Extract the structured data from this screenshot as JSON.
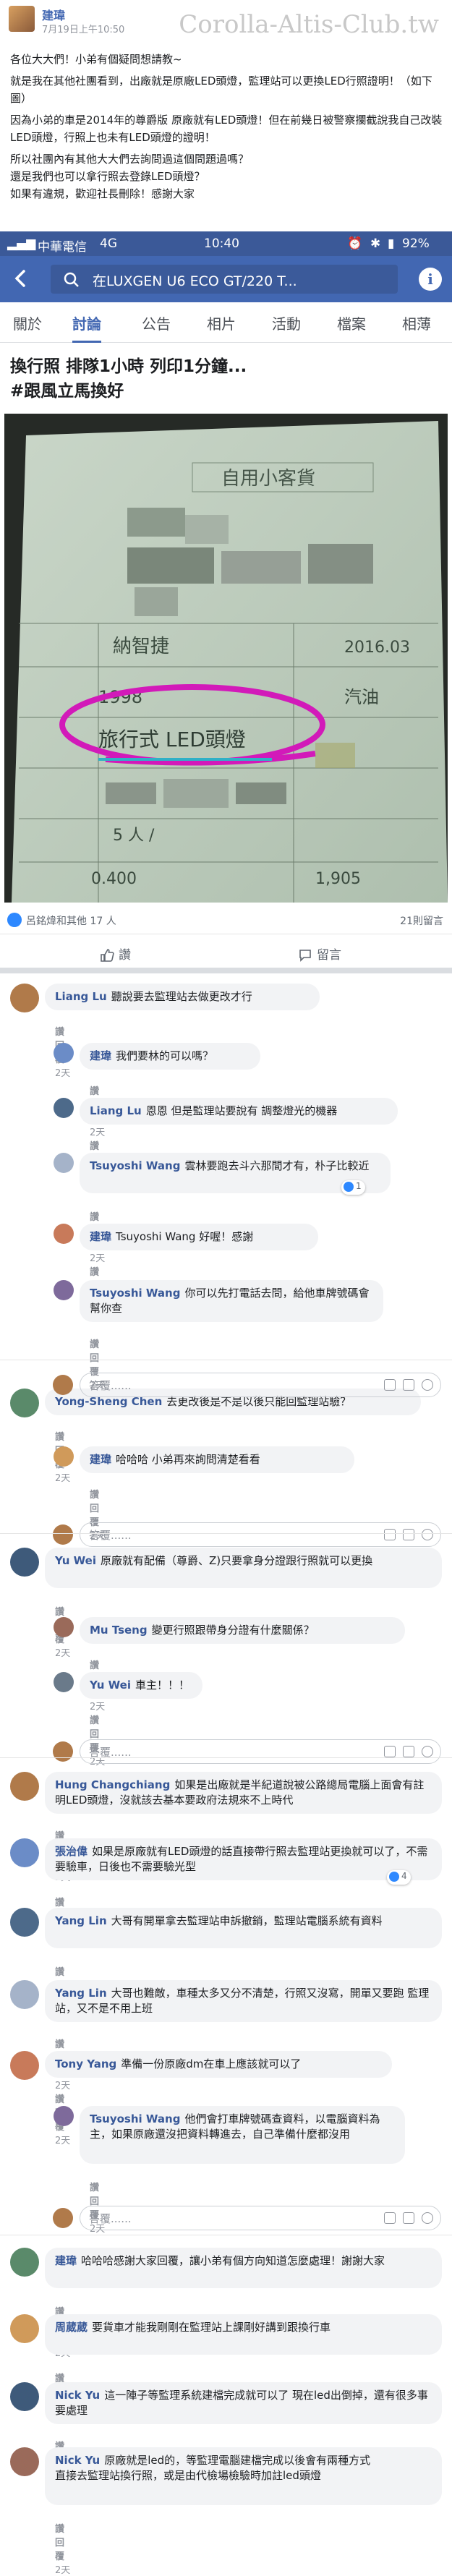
{
  "forum": {
    "author": "建瑋",
    "time": "7月19日上午10:50",
    "watermark": "Corolla-Altis-Club.tw",
    "paragraphs": [
      "各位大大們！小弟有個疑問想請教~",
      "就是我在其他社團看到，出廠就是原廠LED頭燈，監理站可以更換LED行照證明！（如下圖）",
      "因為小弟的車是2014年的尊爵版 原廠就有LED頭燈！但在前幾日被警察攔截說我自己改裝LED頭燈，行照上也未有LED頭燈的證明！",
      "所以社團內有其他大大們去詢問過這個問題過嗎？\n還是我們也可以拿行照去登錄LED頭燈？\n如果有違規，歡迎社長刪除！感謝大家"
    ],
    "highlight_text": "LED行照證明！（如下圖）"
  },
  "status": {
    "carrier": "中華電信",
    "network": "4G",
    "time": "10:40",
    "battery": "92%"
  },
  "appbar": {
    "search_text": "在LUXGEN U6 ECO GT/220 T..."
  },
  "tabs": [
    "關於",
    "討論",
    "公告",
    "相片",
    "活動",
    "檔案",
    "相薄"
  ],
  "post": {
    "title_line1": "換行照 排隊1小時 列印1分鐘...",
    "hashtag": "#跟風立馬換好"
  },
  "photo": {
    "header": "自用小客貨",
    "name": "納智捷",
    "date": "2016.03",
    "year": "1998",
    "fuel": "汽油",
    "led_text": "旅行式 LED頭燈",
    "seats": "5 人 /",
    "weight1": "0.400",
    "weight2": "1,905"
  },
  "reactions": {
    "who": "呂銘煒和其他 17 人",
    "comments_count": "21則留言"
  },
  "actions": {
    "like": "讚",
    "comment": "留言"
  },
  "comments": [
    {
      "name": "Liang Lu",
      "text": "聽說要去監理站去做更改才行",
      "meta_like": "讚",
      "meta_reply": "回覆",
      "meta_time": "2天"
    },
    {
      "name": "建瑋",
      "text": "我們要林的可以嗎？",
      "meta_like": "讚",
      "meta_reply": "回覆",
      "meta_time": "2天"
    },
    {
      "name": "Liang Lu",
      "text": "恩恩 但是監理站要說有 調整燈光的機器",
      "meta_like": "讚",
      "meta_reply": "回覆",
      "meta_time": "2天"
    },
    {
      "name": "Tsuyoshi Wang",
      "text": "雲林要跑去斗六那間才有，朴子比較近",
      "meta_like": "讚",
      "meta_reply": "回覆",
      "meta_time": "2天",
      "pill": "1"
    },
    {
      "name": "建瑋",
      "text": "Tsuyoshi Wang 好喔！感謝",
      "meta_like": "讚",
      "meta_reply": "回覆",
      "meta_time": "2天"
    },
    {
      "name": "Tsuyoshi Wang",
      "text": "你可以先打電話去問，給他車牌號碼會幫你查",
      "meta_like": "讚",
      "meta_reply": "回覆",
      "meta_time": "2天"
    },
    {
      "name": "Yong-Sheng Chen",
      "text": "去更改後是不是以後只能回監理站驗？",
      "meta_like": "讚",
      "meta_reply": "回覆",
      "meta_time": "2天"
    },
    {
      "name": "建瑋",
      "text": "哈哈哈 小弟再來詢問清楚看看",
      "meta_like": "讚",
      "meta_reply": "回覆",
      "meta_time": "2天"
    },
    {
      "name": "Yu Wei",
      "text": "原廠就有配備（尊爵、Z)只要拿身分證跟行照就可以更換",
      "meta_like": "讚",
      "meta_reply": "回覆",
      "meta_time": "2天"
    },
    {
      "name": "Mu Tseng",
      "text": "變更行照跟帶身分證有什麼關係？",
      "meta_like": "讚",
      "meta_reply": "回覆",
      "meta_time": "2天"
    },
    {
      "name": "Yu Wei",
      "text": "車主！！！",
      "meta_like": "讚",
      "meta_reply": "回覆",
      "meta_time": "2天"
    },
    {
      "name": "Hung Changchiang",
      "text": "如果是出廠就是半紀道說被公路總局電腦上面會有註明LED頭燈，沒就該去基本要政府法規來不上時代",
      "meta_like": "讚",
      "meta_reply": "回覆",
      "meta_time": "2天"
    },
    {
      "name": "張治偉",
      "text": "如果是原廠就有LED頭燈的話直接帶行照去監理站更換就可以了，不需要驗車，日後也不需要驗光型",
      "meta_like": "讚",
      "meta_reply": "回覆",
      "meta_time": "2天",
      "pill": "4"
    },
    {
      "name": "Yang Lin",
      "text": "大哥有開單拿去監理站申訴撤銷，監理站電腦系統有資料",
      "meta_like": "讚",
      "meta_reply": "回覆",
      "meta_time": "2天"
    },
    {
      "name": "Yang Lin",
      "text": "大哥也難敵，車種太多又分不清楚，行照又沒寫，開單又要跑 監理站，又不是不用上班",
      "meta_like": "讚",
      "meta_reply": "回覆",
      "meta_time": "2天"
    },
    {
      "name": "Tony Yang",
      "text": "準備一份原廠dm在車上應該就可以了",
      "meta_like": "讚",
      "meta_reply": "回覆",
      "meta_time": "2天"
    },
    {
      "name": "Tsuyoshi Wang",
      "text": "他們會打車牌號碼查資料，以電腦資料為主，如果原廠還沒把資料轉進去，自己準備什麼都沒用",
      "meta_like": "讚",
      "meta_reply": "回覆",
      "meta_time": "2天"
    },
    {
      "name": "建瑋",
      "text": "哈哈哈感謝大家回覆，讓小弟有個方向知道怎麼處理！謝謝大家",
      "meta_like": "讚",
      "meta_reply": "回覆",
      "meta_time": "2天"
    },
    {
      "name": "周葳葳",
      "text": "要貨車才能我剛剛在監理站上課剛好講到跟換行車",
      "meta_like": "讚",
      "meta_reply": "回覆",
      "meta_time": "2天"
    },
    {
      "name": "Nick Yu",
      "text": "這一陣子等監理系統建檔完成就可以了 現在led出倒掉，還有很多事要處理",
      "meta_like": "讚",
      "meta_reply": "回覆",
      "meta_time": "2天"
    },
    {
      "name": "Nick Yu",
      "text": "原廠就是led的，等監理電腦建檔完成以後會有兩種方式\n直接去監理站換行照，或是由代檢場檢驗時加註led頭燈",
      "meta_like": "讚",
      "meta_reply": "回覆",
      "meta_time": "2天"
    }
  ],
  "reply_placeholder": "答覆......",
  "colors": {
    "brand": "#4267b2",
    "status_bar": "#3b5998",
    "link": "#385898"
  }
}
